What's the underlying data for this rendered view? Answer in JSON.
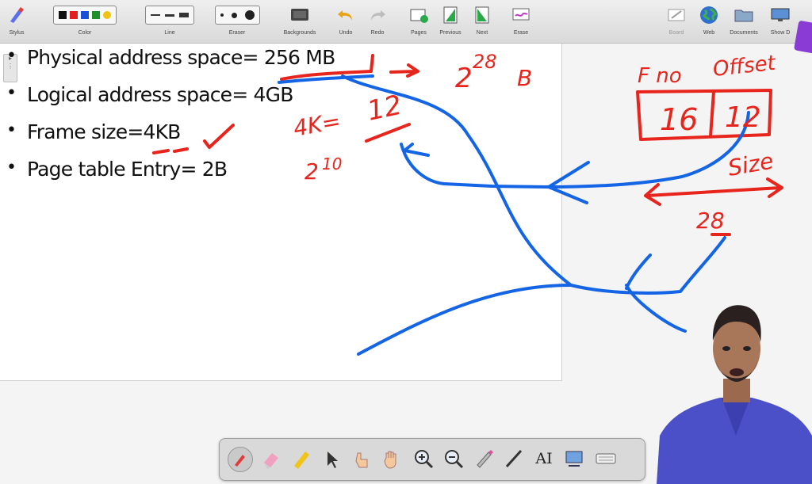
{
  "toolbar": {
    "labels": {
      "stylus": "Stylus",
      "color": "Color",
      "line": "Line",
      "eraser": "Eraser",
      "backgrounds": "Backgrounds",
      "undo": "Undo",
      "redo": "Redo",
      "pages": "Pages",
      "previous": "Previous",
      "next": "Next",
      "erase": "Erase",
      "board": "Board",
      "web": "Web",
      "documents": "Documents",
      "show_desktop": "Show D"
    },
    "colors": [
      "#111111",
      "#e02020",
      "#1a4fd6",
      "#1f8f2a",
      "#f2c40f"
    ]
  },
  "slide": {
    "bullets": [
      "Physical address space= 256 MB",
      "Logical address space= 4GB",
      "Frame size=4KB",
      "Page table Entry= 2B"
    ]
  },
  "handwriting": {
    "power": "2",
    "power_exp": "28",
    "unit": "B",
    "size_label": "4K=",
    "size_value": "12",
    "size_frac_top": "2",
    "size_frac_exp": "10",
    "frame_no": "F no",
    "offset": "Offset",
    "frame_bits": "16",
    "offset_bits": "12",
    "size_word": "Size",
    "range_label": "28",
    "ink_red": "#e8251c",
    "ink_blue": "#1464e6"
  },
  "bottom_toolbar": {
    "text_tool": "AI"
  }
}
